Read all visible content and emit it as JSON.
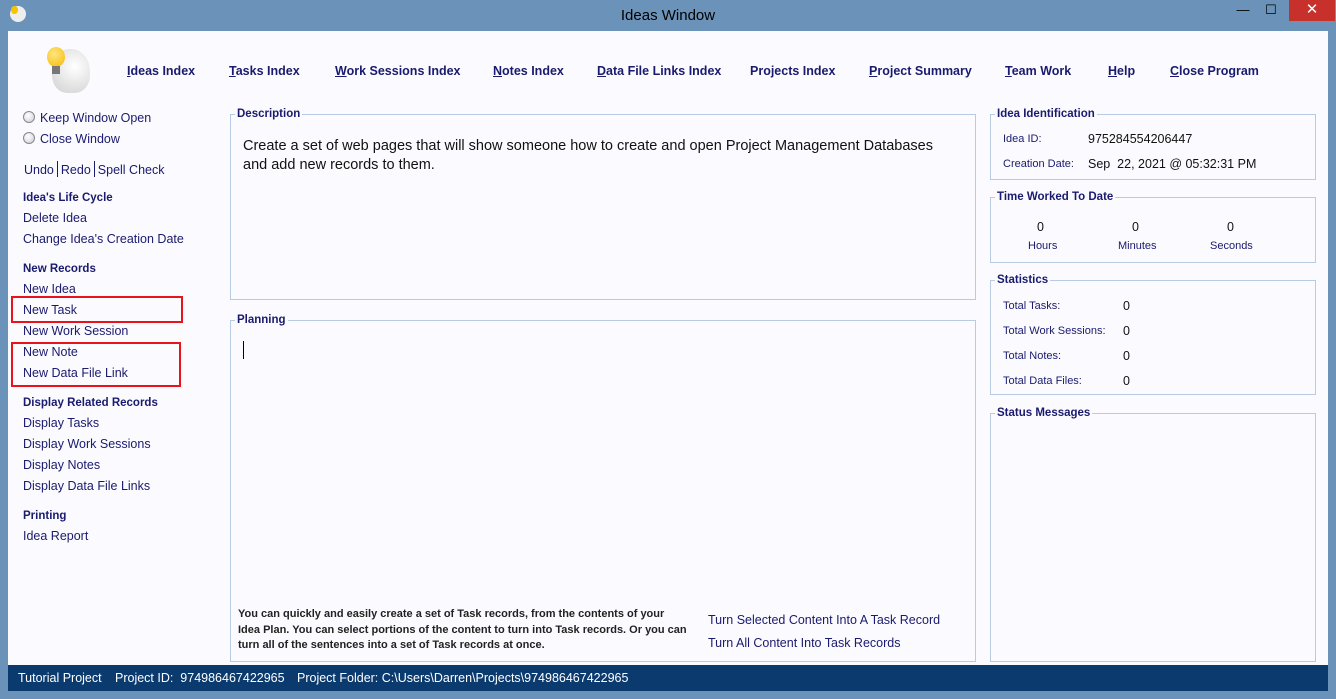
{
  "window": {
    "title": "Ideas Window",
    "minimize": "—",
    "maximize": "☐",
    "close": "✕"
  },
  "nav": [
    {
      "key": "I",
      "rest": "deas Index"
    },
    {
      "key": "T",
      "rest": "asks Index"
    },
    {
      "key": "W",
      "rest": "ork Sessions Index"
    },
    {
      "key": "N",
      "rest": "otes Index"
    },
    {
      "key": "D",
      "rest": "ata File Links Index"
    },
    {
      "key": "",
      "rest": "Projects Index"
    },
    {
      "key": "P",
      "rest": "roject Summary"
    },
    {
      "key": "T",
      "rest": "eam Work"
    },
    {
      "key": "H",
      "rest": "elp"
    },
    {
      "key": "C",
      "rest": "lose Program"
    }
  ],
  "sidebar": {
    "keep_open": "Keep Window Open",
    "close_window": "Close Window",
    "undo": "Undo",
    "redo": "Redo",
    "spell_check": "Spell Check",
    "lifecycle_header": "Idea's Life Cycle",
    "delete_idea": "Delete Idea",
    "change_date": "Change Idea's Creation Date",
    "new_records_header": "New Records",
    "new_idea": "New Idea",
    "new_task": "New Task",
    "new_work_session": "New Work Session",
    "new_note": "New Note",
    "new_data_file_link": "New Data File Link",
    "display_header": "Display Related Records",
    "display_tasks": "Display Tasks",
    "display_work_sessions": "Display Work Sessions",
    "display_notes": "Display Notes",
    "display_data_file_links": "Display Data File Links",
    "printing_header": "Printing",
    "idea_report": "Idea Report"
  },
  "description": {
    "label": "Description",
    "text": "Create a set of web pages that will show someone how to create and open Project Management Databases and add new records to them."
  },
  "planning": {
    "label": "Planning",
    "text": "",
    "hint": "You can quickly and easily create a set of Task records, from the contents of your Idea Plan. You can select portions of the content to turn into Task records. Or you can turn all of the sentences into a set of Task records at once.",
    "turn_selected": "Turn Selected Content Into A Task Record",
    "turn_all": "Turn All Content Into Task Records"
  },
  "identification": {
    "label": "Idea Identification",
    "id_label": "Idea ID:",
    "id": "975284554206447",
    "date_label": "Creation Date:",
    "date": "Sep  22, 2021 @ 05:32:31 PM"
  },
  "time_worked": {
    "label": "Time Worked To Date",
    "hours": "0",
    "hours_label": "Hours",
    "minutes": "0",
    "minutes_label": "Minutes",
    "seconds": "0",
    "seconds_label": "Seconds"
  },
  "statistics": {
    "label": "Statistics",
    "tasks_label": "Total Tasks:",
    "tasks": "0",
    "sessions_label": "Total Work Sessions:",
    "sessions": "0",
    "notes_label": "Total Notes:",
    "notes": "0",
    "files_label": "Total Data Files:",
    "files": "0"
  },
  "status_messages": {
    "label": "Status Messages"
  },
  "statusbar": {
    "project": "Tutorial Project",
    "project_id": "Project ID:  974986467422965",
    "folder": "Project Folder: C:\\Users\\Darren\\Projects\\974986467422965"
  }
}
